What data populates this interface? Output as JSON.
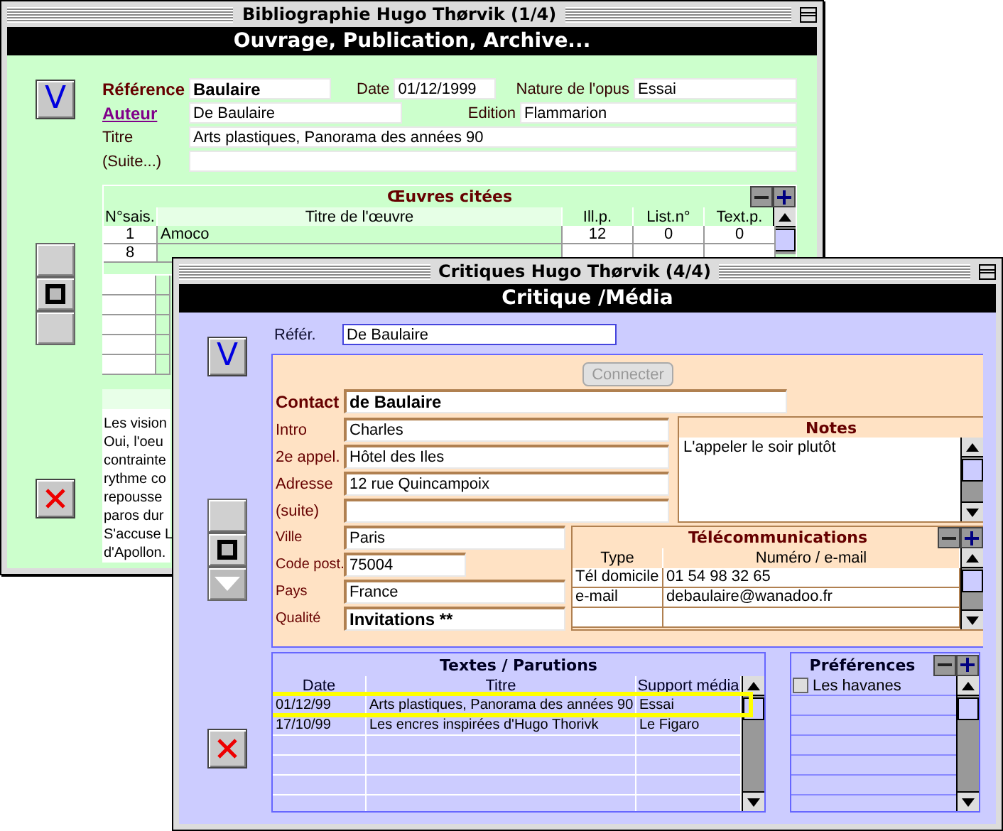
{
  "back_window": {
    "title": "Bibliographie Hugo Thørvik (1/4)",
    "header": "Ouvrage, Publication, Archive...",
    "validate_button": "V",
    "reference": {
      "label": "Référence",
      "value": "Baulaire"
    },
    "date": {
      "label": "Date",
      "value": "01/12/1999"
    },
    "nature": {
      "label": "Nature de l'opus",
      "value": "Essai"
    },
    "author": {
      "label": "Auteur",
      "value": "De Baulaire"
    },
    "edition": {
      "label": "Edition",
      "value": "Flammarion"
    },
    "title_field": {
      "label": "Titre",
      "value": "Arts plastiques, Panorama des années 90"
    },
    "continuation": {
      "label": "(Suite...)"
    },
    "works_table": {
      "title": "Œuvres citées",
      "columns": [
        "N°sais.",
        "Titre de l'œuvre",
        "Ill.p.",
        "List.n°",
        "Text.p."
      ],
      "rows": [
        {
          "cells": [
            "1",
            "Amoco",
            "12",
            "0",
            "0"
          ]
        },
        {
          "cells": [
            "8"
          ]
        }
      ]
    },
    "notes_lines": [
      "Les vision",
      "Oui, l'oeu",
      "contrainte",
      "rythme co",
      "repousse",
      "paros dur",
      "S'accuse L",
      "d'Apollon."
    ]
  },
  "front_window": {
    "title": "Critiques Hugo Thørvik (4/4)",
    "header": "Critique /Média",
    "validate_button": "V",
    "refer": {
      "label": "Référ.",
      "value": "De Baulaire"
    },
    "connect_button": {
      "label": "Connecter",
      "disabled": true
    },
    "contact": {
      "label": "Contact",
      "value": "de Baulaire"
    },
    "address_fields": [
      {
        "label": "Intro",
        "value": "Charles"
      },
      {
        "label": "2e appel.",
        "value": "Hôtel des Iles"
      },
      {
        "label": "Adresse",
        "value": "12 rue Quincampoix"
      },
      {
        "label": "(suite)"
      }
    ],
    "location_fields": [
      {
        "label": "Ville",
        "value": "Paris",
        "kind": "wide"
      },
      {
        "label": "Code post.",
        "value": "75004",
        "kind": "short"
      },
      {
        "label": "Pays",
        "value": "France",
        "kind": "wide"
      },
      {
        "label": "Qualité",
        "value": "Invitations **",
        "kind": "bold"
      }
    ],
    "notes": {
      "title": "Notes",
      "text": "L'appeler le soir plutôt"
    },
    "telecom": {
      "title": "Télécommunications",
      "columns": [
        "Type",
        "Numéro / e-mail"
      ],
      "rows": [
        {
          "cells": [
            "Tél domicile",
            "01 54 98 32 65"
          ]
        },
        {
          "cells": [
            "e-mail",
            "debaulaire@wanadoo.fr"
          ]
        }
      ]
    },
    "publications": {
      "title": "Textes / Parutions",
      "columns": [
        "Date",
        "Titre",
        "Support média"
      ],
      "rows": [
        {
          "cells": [
            "01/12/99",
            "Arts plastiques, Panorama des années 90",
            "Essai"
          ],
          "highlighted": true
        },
        {
          "cells": [
            "17/10/99",
            "Les encres inspirées d'Hugo Thorivk",
            "Le Figaro"
          ],
          "highlighted": false
        }
      ]
    },
    "preferences": {
      "title": "Préférences",
      "items": [
        {
          "label": "Les havanes",
          "checked": false
        }
      ]
    }
  }
}
